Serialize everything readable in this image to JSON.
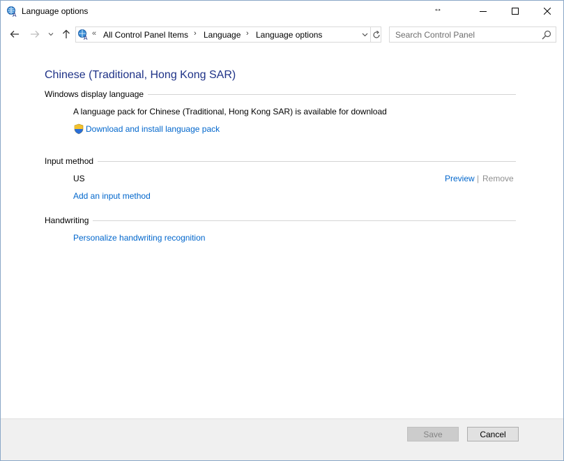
{
  "window": {
    "title": "Language options",
    "resize_glyph": "↔"
  },
  "nav": {
    "overflow_chevron": "«",
    "breadcrumbs": [
      "All Control Panel Items",
      "Language",
      "Language options"
    ],
    "crumb_separator": "›",
    "search": {
      "placeholder": "Search Control Panel",
      "value": ""
    }
  },
  "content": {
    "language_name": "Chinese (Traditional, Hong Kong SAR)",
    "display_language": {
      "header": "Windows display language",
      "availability_text": "A language pack for Chinese (Traditional, Hong Kong SAR) is available for download",
      "download_link": "Download and install language pack"
    },
    "input_method": {
      "header": "Input method",
      "methods": [
        {
          "name": "US",
          "preview_label": "Preview",
          "separator": "|",
          "remove_label": "Remove"
        }
      ],
      "add_link": "Add an input method"
    },
    "handwriting": {
      "header": "Handwriting",
      "personalize_link": "Personalize handwriting recognition"
    }
  },
  "footer": {
    "save_label": "Save",
    "cancel_label": "Cancel"
  },
  "colors": {
    "title_blue": "#1e3287",
    "link_blue": "#0066cc",
    "disabled_gray": "#8f8f8f",
    "footer_bg": "#f0f0f0"
  },
  "icons": {
    "app": "language-globe-icon",
    "back": "back-arrow-icon",
    "forward": "forward-arrow-icon",
    "recent": "chevron-down-icon",
    "up": "up-arrow-icon",
    "refresh": "refresh-icon",
    "search": "search-icon",
    "shield": "uac-shield-icon"
  }
}
